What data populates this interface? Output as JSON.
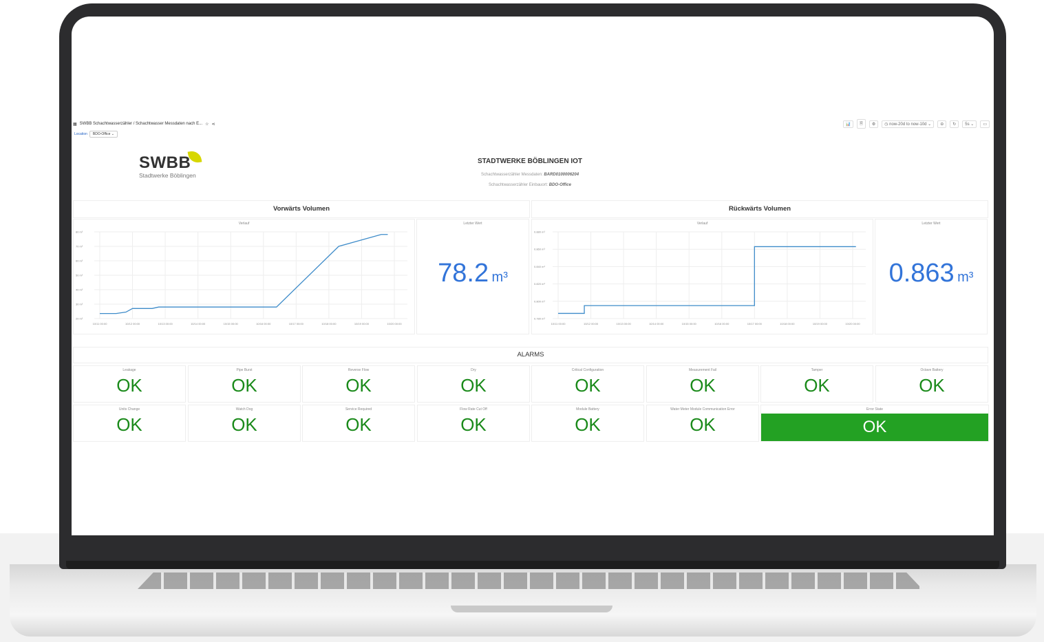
{
  "topbar": {
    "breadcrumb": "SWBB Schachtwasserzähler / Schachtwasser Messdaten nach E...",
    "time_range": "now-20d to now-10d",
    "refresh": "5s"
  },
  "filter": {
    "label": "Location",
    "value": "BDO-Office"
  },
  "header": {
    "logo_text": "SWBB",
    "logo_sub": "Stadtwerke Böblingen",
    "title": "STADTWERKE BÖBLINGEN IOT",
    "line1_label": "Schachtwasserzähler Messdaten:",
    "line1_value": "BARD0100006204",
    "line2_label": "Schachtwasserzähler Einbauort:",
    "line2_value": "BDO-Office"
  },
  "forward": {
    "title": "Vorwärts Volumen",
    "graph_title": "Verlauf",
    "stat_title": "Letzter Wert",
    "stat_value": "78.2",
    "stat_unit": "m³"
  },
  "reverse": {
    "title": "Rückwärts Volumen",
    "graph_title": "Verlauf",
    "stat_title": "Letzter Wert",
    "stat_value": "0.863",
    "stat_unit": "m³"
  },
  "alarms": {
    "title": "ALARMS",
    "row1": [
      {
        "name": "Leakage",
        "value": "OK"
      },
      {
        "name": "Pipe Burst",
        "value": "OK"
      },
      {
        "name": "Reverse Flow",
        "value": "OK"
      },
      {
        "name": "Dry",
        "value": "OK"
      },
      {
        "name": "Critical Configuration",
        "value": "OK"
      },
      {
        "name": "Measurement Fail",
        "value": "OK"
      },
      {
        "name": "Tamper",
        "value": "OK"
      },
      {
        "name": "Octave Battery",
        "value": "OK"
      }
    ],
    "row2": [
      {
        "name": "Units Change",
        "value": "OK"
      },
      {
        "name": "Watch Dog",
        "value": "OK"
      },
      {
        "name": "Service Required",
        "value": "OK"
      },
      {
        "name": "Flow Rate Cut Off",
        "value": "OK"
      },
      {
        "name": "Module Battery",
        "value": "OK"
      },
      {
        "name": "Water Meter Module Communication Error",
        "value": "OK"
      }
    ],
    "error_state": {
      "name": "Error State",
      "value": "OK"
    }
  },
  "chart_data": [
    {
      "type": "line",
      "title": "Verlauf",
      "x": [
        "10/11 00:00",
        "10/12 00:00",
        "10/13 00:00",
        "10/14 00:00",
        "10/15 00:00",
        "10/16 00:00",
        "10/17 00:00",
        "10/18 00:00",
        "10/19 00:00",
        "10/20 00:00"
      ],
      "y_ticks": [
        "20 m³",
        "30 m³",
        "40 m³",
        "50 m³",
        "60 m³",
        "70 m³",
        "80 m³"
      ],
      "ylim": [
        20,
        80
      ],
      "series": [
        {
          "values": [
            {
              "x": 0,
              "y": 23.5
            },
            {
              "x": 0.5,
              "y": 23.5
            },
            {
              "x": 0.8,
              "y": 24.5
            },
            {
              "x": 1.0,
              "y": 27
            },
            {
              "x": 1.6,
              "y": 27
            },
            {
              "x": 1.8,
              "y": 28
            },
            {
              "x": 5.4,
              "y": 28
            },
            {
              "x": 7.3,
              "y": 70
            },
            {
              "x": 8.6,
              "y": 78.2
            },
            {
              "x": 8.8,
              "y": 78.2
            }
          ]
        }
      ],
      "color": "#3d8bc9",
      "grid": true
    },
    {
      "type": "line",
      "title": "Verlauf",
      "x": [
        "10/11 00:00",
        "10/12 00:00",
        "10/13 00:00",
        "10/14 00:00",
        "10/15 00:00",
        "10/16 00:00",
        "10/17 00:00",
        "10/18 00:00",
        "10/19 00:00",
        "10/20 00:00"
      ],
      "y_ticks": [
        "0.780 m³",
        "0.800 m³",
        "0.820 m³",
        "0.840 m³",
        "0.860 m³",
        "0.880 m³"
      ],
      "ylim": [
        0.78,
        0.88
      ],
      "series": [
        {
          "values": [
            {
              "x": 0,
              "y": 0.786
            },
            {
              "x": 0.8,
              "y": 0.786
            },
            {
              "x": 0.8,
              "y": 0.795
            },
            {
              "x": 6.0,
              "y": 0.795
            },
            {
              "x": 6.0,
              "y": 0.863
            },
            {
              "x": 9.1,
              "y": 0.863
            }
          ]
        }
      ],
      "color": "#3d8bc9",
      "grid": true
    }
  ]
}
